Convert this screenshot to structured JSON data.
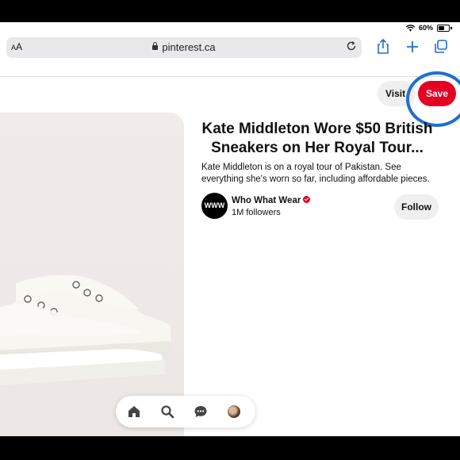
{
  "status_bar": {
    "battery": "60%",
    "wifi_icon": "wifi-icon",
    "battery_icon": "battery-icon"
  },
  "browser": {
    "text_size_label": "AA",
    "url": "pinterest.ca",
    "icons": [
      "lock-icon",
      "reload-icon",
      "share-icon",
      "plus-icon",
      "tabs-icon"
    ]
  },
  "pin": {
    "visit_label": "Visit",
    "save_label": "Save",
    "title": "Kate Middleton Wore $50 British Sneakers on Her Royal Tour...",
    "description": "Kate Middleton is on a royal tour of Pakistan. See everything she's worn so far, including affordable pieces.",
    "author": {
      "avatar_text": "WWW",
      "name": "Who What Wear",
      "followers": "1M followers",
      "follow_label": "Follow"
    }
  },
  "bottom_nav": {
    "icons": [
      "home-icon",
      "search-icon",
      "messages-icon",
      "profile-avatar"
    ]
  },
  "colors": {
    "accent": "#e60023",
    "highlight_ring": "#1f6fd1"
  }
}
